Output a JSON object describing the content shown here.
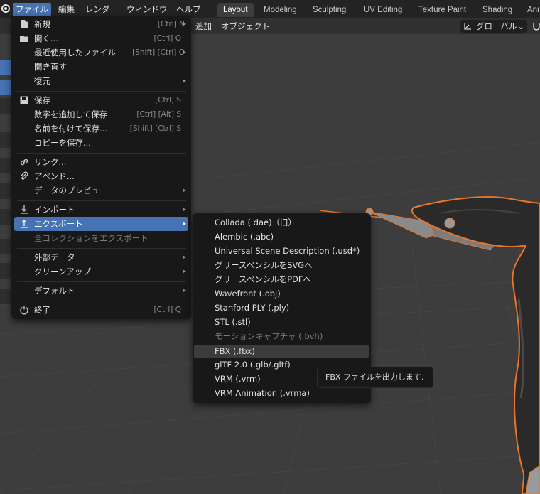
{
  "topbar": {
    "menus": [
      "ファイル",
      "編集",
      "レンダー",
      "ウィンドウ",
      "ヘルプ"
    ],
    "workspaces": [
      "Layout",
      "Modeling",
      "Sculpting",
      "UV Editing",
      "Texture Paint",
      "Shading",
      "Ani"
    ]
  },
  "viewport_header": {
    "menus": [
      "追加",
      "オブジェクト"
    ],
    "orientation": "グローバル"
  },
  "file_menu": {
    "new": {
      "label": "新規",
      "shortcut": "[Ctrl] N"
    },
    "open": {
      "label": "開く...",
      "shortcut": "[Ctrl] O"
    },
    "open_recent": {
      "label": "最近使用したファイル",
      "shortcut": "[Shift] [Ctrl] O"
    },
    "revert": {
      "label": "開き直す"
    },
    "recover": {
      "label": "復元"
    },
    "save": {
      "label": "保存",
      "shortcut": "[Ctrl] S"
    },
    "save_incremental": {
      "label": "数字を追加して保存",
      "shortcut": "[Ctrl] [Alt] S"
    },
    "save_as": {
      "label": "名前を付けて保存...",
      "shortcut": "[Shift] [Ctrl] S"
    },
    "save_copy": {
      "label": "コピーを保存..."
    },
    "link": {
      "label": "リンク..."
    },
    "append": {
      "label": "アペンド..."
    },
    "data_previews": {
      "label": "データのプレビュー"
    },
    "import": {
      "label": "インポート"
    },
    "export": {
      "label": "エクスポート"
    },
    "export_all_collections": {
      "label": "全コレクションをエクスポート"
    },
    "external_data": {
      "label": "外部データ"
    },
    "cleanup": {
      "label": "クリーンアップ"
    },
    "defaults": {
      "label": "デフォルト"
    },
    "quit": {
      "label": "終了",
      "shortcut": "[Ctrl] Q"
    }
  },
  "export_menu": {
    "items": [
      "Collada (.dae)（旧）",
      "Alembic (.abc)",
      "Universal Scene Description (.usd*)",
      "グリースペンシルをSVGへ",
      "グリースペンシルをPDFへ",
      "Wavefront (.obj)",
      "Stanford PLY (.ply)",
      "STL (.stl)",
      "モーションキャプチャ (.bvh)",
      "FBX (.fbx)",
      "glTF 2.0 (.glb/.gltf)",
      "VRM (.vrm)",
      "VRM Animation (.vrma)"
    ],
    "disabled_index": 8,
    "highlighted_index": 9
  },
  "tooltip": {
    "text": "FBX ファイルを出力します."
  },
  "colors": {
    "accent": "#4772b3",
    "menu_bg": "#181818",
    "selection_outline": "#e8762c"
  }
}
